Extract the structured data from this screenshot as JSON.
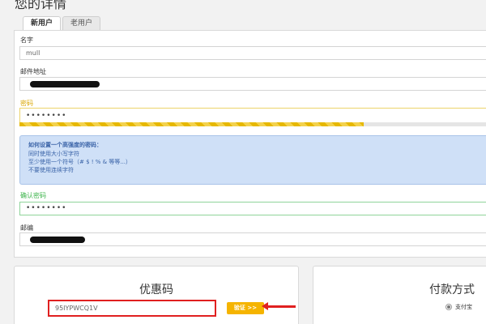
{
  "page": {
    "title": "您的详情"
  },
  "tabs": [
    {
      "label": "新用户",
      "active": true
    },
    {
      "label": "老用户",
      "active": false
    }
  ],
  "form": {
    "name": {
      "label": "名字",
      "value": "mull"
    },
    "email": {
      "label": "邮件地址",
      "value": ""
    },
    "password": {
      "label": "密码",
      "value": "••••••••",
      "strength": 0.72,
      "color": "#e6b800"
    },
    "tips": {
      "title": "如何设置一个高强度的密码：",
      "lines": [
        "同时使用大小写字符",
        "至少使用一个符号（# $ ! % & 等等...）",
        "不要使用连续字符"
      ]
    },
    "confirm_password": {
      "label": "确认密码",
      "value": "••••••••"
    },
    "postcode": {
      "label": "邮编",
      "value": ""
    }
  },
  "coupon": {
    "title": "优惠码",
    "value": "95IYPWCQ1V",
    "verify_label": "验证 >>"
  },
  "payment": {
    "title": "付款方式",
    "option_label": "支付宝"
  },
  "colors": {
    "accent": "#f5b400",
    "highlight": "#e02020",
    "success": "#3cb44b",
    "info_bg": "#cfe0f7"
  }
}
